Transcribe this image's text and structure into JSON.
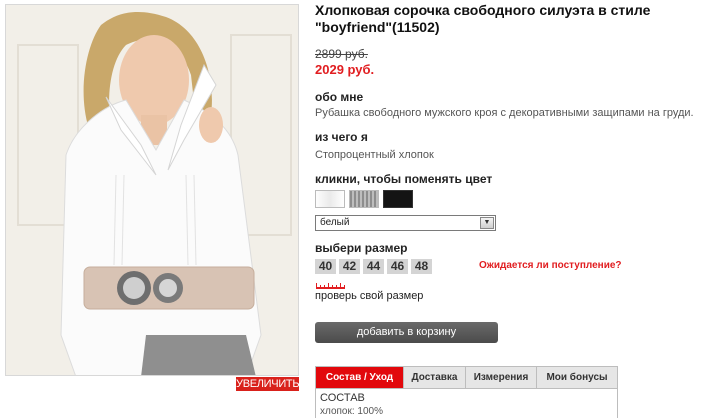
{
  "image": {
    "zoom_label": "УВЕЛИЧИТЬ"
  },
  "product": {
    "title_line1": "Хлопковая сорочка свободного силуэта в стиле",
    "title_line2": "\"boyfriend\"(11502)",
    "old_price": "2899 руб.",
    "new_price": "2029 руб."
  },
  "about": {
    "heading": "обо мне",
    "text": "Рубашка свободного мужского кроя с декоративными защипами на груди."
  },
  "material": {
    "heading": "из чего я",
    "text": "Стопроцентный хлопок"
  },
  "colors": {
    "heading": "кликни, чтобы поменять цвет",
    "swatches": [
      "white",
      "grey",
      "black"
    ],
    "selected": "белый"
  },
  "sizes": {
    "heading": "выбери размер",
    "options": [
      "40",
      "42",
      "44",
      "46",
      "48"
    ],
    "wait_link": "Ожидается ли поступление?",
    "check_link": "проверь свой размер"
  },
  "cart": {
    "button_label": "добавить в корзину"
  },
  "tabs": {
    "items": [
      "Состав / Уход",
      "Доставка",
      "Измерения",
      "Мои бонусы"
    ],
    "active_heading": "СОСТАВ",
    "active_text": "хлопок: 100%"
  },
  "colors_theme": {
    "accent_red": "#e11d20",
    "button_dark": "#4b4b4b",
    "size_bg": "#d4d4d4"
  }
}
